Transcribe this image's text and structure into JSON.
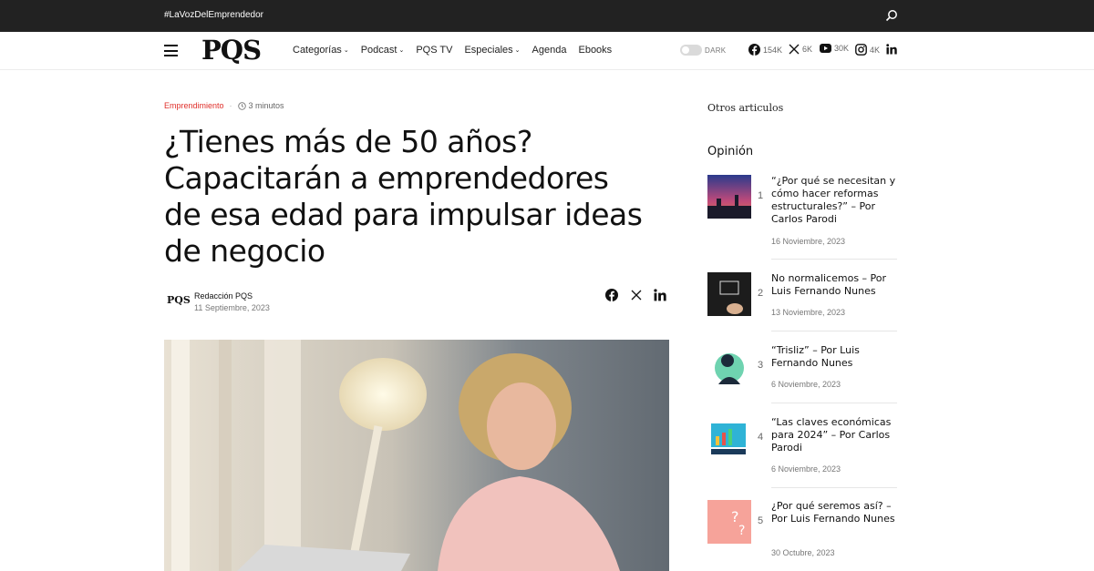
{
  "topbar": {
    "hashtag": "#LaVozDelEmprendedor",
    "search_icon": "search-icon"
  },
  "header": {
    "logo": "PQS",
    "nav": [
      {
        "label": "Categorías",
        "has_dropdown": true
      },
      {
        "label": "Podcast",
        "has_dropdown": true
      },
      {
        "label": "PQS TV",
        "has_dropdown": false
      },
      {
        "label": "Especiales",
        "has_dropdown": true
      },
      {
        "label": "Agenda",
        "has_dropdown": false
      },
      {
        "label": "Ebooks",
        "has_dropdown": false
      }
    ],
    "dark_mode_label": "DARK",
    "social": {
      "facebook": "154K",
      "x": "6K",
      "youtube": "30K",
      "instagram": "4K"
    }
  },
  "article": {
    "category": "Emprendimiento",
    "read_time": "3 minutos",
    "title_lines": [
      "¿Tienes más de 50 años?",
      "Capacitarán a emprendedores",
      "de esa edad para impulsar ideas",
      "de negocio"
    ],
    "author_logo": "PQS",
    "author_name": "Redacción PQS",
    "date": "11 Septiembre, 2023"
  },
  "sidebar": {
    "heading": "Otros articulos",
    "section": "Opinión",
    "items": [
      {
        "num": "1",
        "title": "“¿Por qué se necesitan y cómo hacer reformas estructurales?” – Por Carlos Parodi",
        "date": "16 Noviembre, 2023"
      },
      {
        "num": "2",
        "title": "No normalicemos – Por Luis Fernando Nunes",
        "date": "13 Noviembre, 2023"
      },
      {
        "num": "3",
        "title": "“Trisliz” – Por Luis Fernando Nunes",
        "date": "6 Noviembre, 2023"
      },
      {
        "num": "4",
        "title": "“Las claves económicas para 2024” – Por Carlos Parodi",
        "date": "6 Noviembre, 2023"
      },
      {
        "num": "5",
        "title": "¿Por qué seremos así? – Por Luis Fernando Nunes",
        "date": "30 Octubre, 2023"
      }
    ]
  },
  "colors": {
    "accent": "#e0302b",
    "topbar": "#222222"
  }
}
